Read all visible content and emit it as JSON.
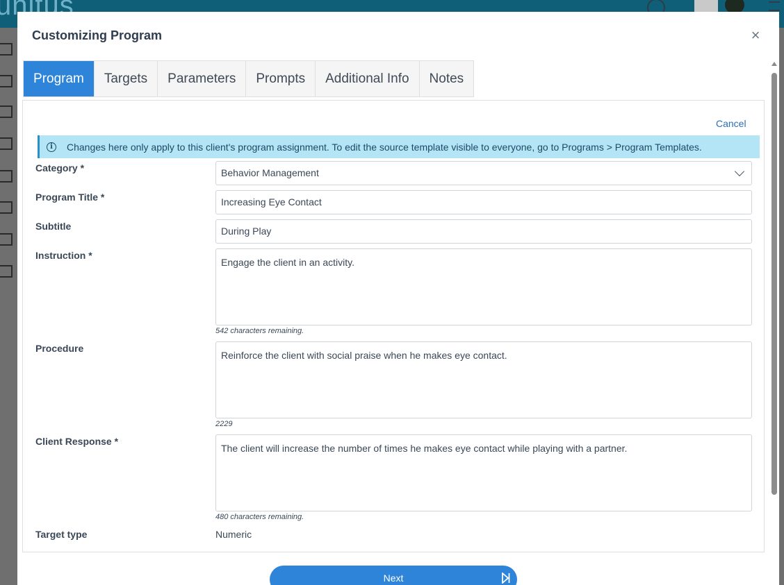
{
  "background": {
    "logo_text": "unitus",
    "accent": "#0f5f78"
  },
  "modal": {
    "title": "Customizing Program",
    "close_icon": "close-icon"
  },
  "tabs": [
    {
      "label": "Program",
      "active": true
    },
    {
      "label": "Targets",
      "active": false
    },
    {
      "label": "Parameters",
      "active": false
    },
    {
      "label": "Prompts",
      "active": false
    },
    {
      "label": "Additional Info",
      "active": false
    },
    {
      "label": "Notes",
      "active": false
    }
  ],
  "panel": {
    "cancel_label": "Cancel",
    "info_message": "Changes here only apply to this client's program assignment. To edit the source template visible to everyone, go to Programs > Program Templates."
  },
  "form": {
    "category": {
      "label": "Category *",
      "value": "Behavior Management"
    },
    "program_title": {
      "label": "Program Title *",
      "value": "Increasing Eye Contact"
    },
    "subtitle": {
      "label": "Subtitle",
      "value": "During Play"
    },
    "instruction": {
      "label": "Instruction *",
      "value": "Engage the client in an activity.",
      "hint": "542 characters remaining."
    },
    "procedure": {
      "label": "Procedure",
      "value": "Reinforce the client with social praise when he makes eye contact.",
      "hint": "2229"
    },
    "client_response": {
      "label": "Client Response *",
      "value": "The client will increase the number of times he makes eye contact while playing with a partner.",
      "hint": "480 characters remaining."
    },
    "target_type": {
      "label": "Target type",
      "value": "Numeric"
    }
  },
  "footer": {
    "next_label": "Next"
  },
  "colors": {
    "primary": "#2d84d8",
    "info_bg": "#b3e5f7"
  }
}
